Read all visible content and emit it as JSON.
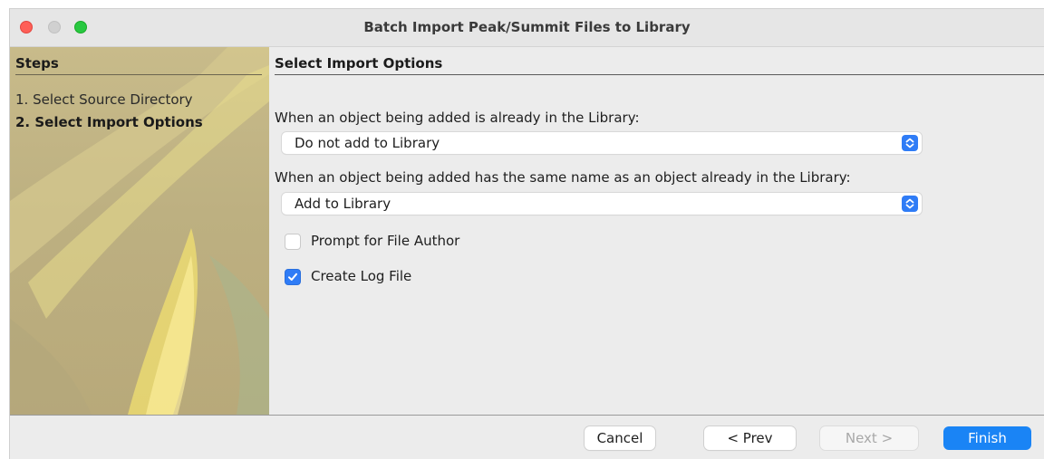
{
  "window": {
    "title": "Batch Import Peak/Summit Files to Library",
    "controls": [
      "close",
      "minimize",
      "zoom"
    ]
  },
  "sidebar": {
    "heading": "Steps",
    "steps": [
      {
        "label": "1. Select Source Directory",
        "current": false
      },
      {
        "label": "2. Select Import Options",
        "current": true
      }
    ]
  },
  "main": {
    "heading": "Select Import Options",
    "options": [
      {
        "label": "When an object being added is already in the Library:",
        "value": "Do not add to Library"
      },
      {
        "label": "When an object being added has the same name as an object already in the Library:",
        "value": "Add to Library"
      }
    ],
    "checkboxes": [
      {
        "label": "Prompt for File Author",
        "checked": false
      },
      {
        "label": "Create Log File",
        "checked": true
      }
    ]
  },
  "footer": {
    "cancel_label": "Cancel",
    "prev_label": "< Prev",
    "next_label": "Next >",
    "next_enabled": false,
    "finish_label": "Finish"
  },
  "colors": {
    "accent": "#1a84f5",
    "close": "#fe5f57",
    "zoom": "#28c840",
    "sidebar": "#c3b584"
  }
}
